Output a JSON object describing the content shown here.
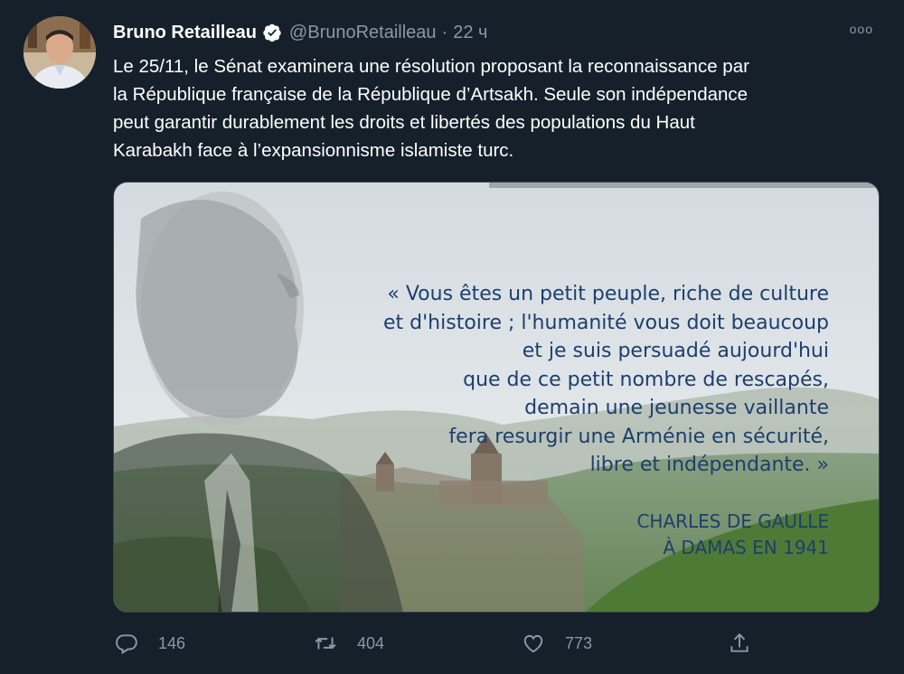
{
  "tweet": {
    "author_name": "Bruno Retailleau",
    "handle": "@BrunoRetailleau",
    "separator": "·",
    "time": "22 ч",
    "more_label": "ooo",
    "text_lines": [
      "Le 25/11, le Sénat examinera une résolution proposant la reconnaissance par",
      "la République française de la République d’Artsakh. Seule son indépendance",
      "peut garantir durablement les droits et libertés des populations du Haut",
      "Karabakh face à l’expansionnisme islamiste turc."
    ]
  },
  "media": {
    "quote_lines": [
      "« Vous êtes un petit peuple, riche de culture",
      "et d'histoire ; l'humanité vous doit beaucoup",
      "et je suis persuadé aujourd'hui",
      "que de ce petit nombre de rescapés,",
      "demain une jeunesse vaillante",
      "fera resurgir une Arménie en sécurité,",
      "libre et indépendante. »"
    ],
    "author_lines": [
      "CHARLES DE GAULLE",
      "À DAMAS EN 1941"
    ]
  },
  "actions": {
    "replies": "146",
    "retweets": "404",
    "likes": "773"
  },
  "icons": {
    "reply": "reply-icon",
    "retweet": "retweet-icon",
    "like": "heart-icon",
    "share": "share-icon",
    "verified": "verified-badge-icon",
    "more": "more-options-icon"
  },
  "colors": {
    "background": "#15202b",
    "text_primary": "#ffffff",
    "text_secondary": "#8899a6",
    "quote_text": "#1c3f6e"
  }
}
